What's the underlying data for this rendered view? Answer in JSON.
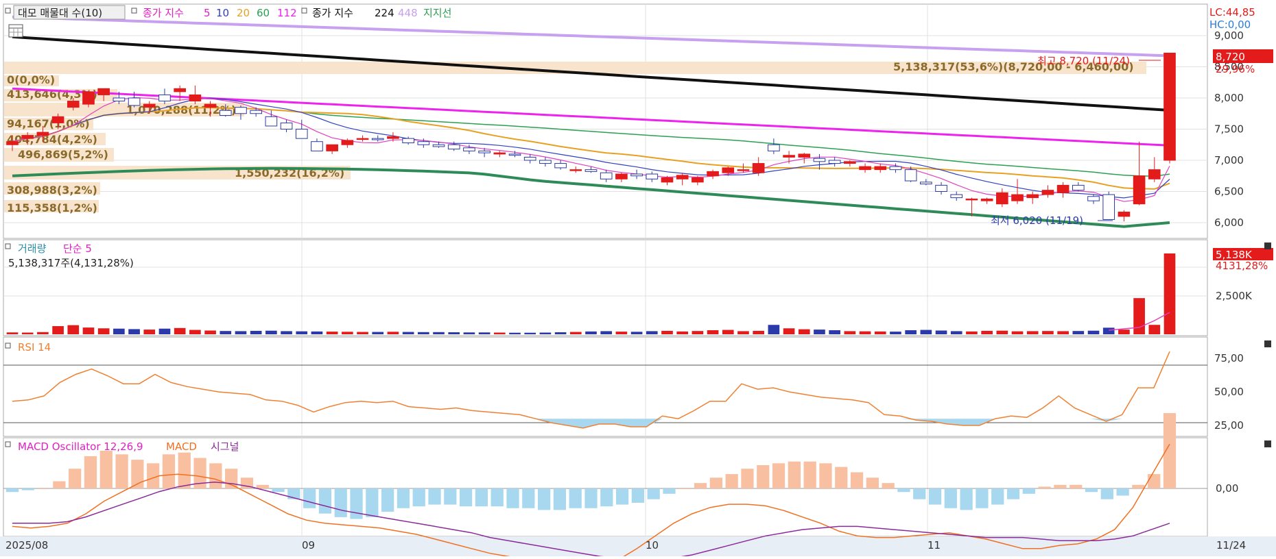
{
  "colors": {
    "up": "#e31b1b",
    "down": "#2b3aa8",
    "ma5": "#e040c0",
    "ma10": "#3040c0",
    "ma20": "#e8a020",
    "ma60": "#2aa050",
    "ma112": "#ee22ee",
    "ma224": "#111111",
    "ma448": "#c8a0f0",
    "support": "#2e8b57",
    "rsi": "#f08030",
    "macd": "#f07020",
    "signal": "#8a2a9a",
    "osc_pos": "#f8c0a0",
    "osc_neg": "#a8d8f0",
    "profile": "#f8e4cc",
    "profile_text": "#8a6a2a",
    "grid": "#e0e0e0"
  },
  "header": {
    "volume_profile_label": "대모 매물대 수(10)",
    "ma_label": "종가 지수",
    "ma_periods_a": [
      "5",
      "10",
      "20",
      "60",
      "112"
    ],
    "ma_label2": "종가 지수",
    "ma_periods_b": [
      "224",
      "448"
    ],
    "support_label": "지지선"
  },
  "price_panel": {
    "lc": "LC:44,85",
    "hc": "HC:0,00",
    "y_ticks": [
      "9,000",
      "8,500",
      "8,000",
      "7,500",
      "7,000",
      "6,500",
      "6,000"
    ],
    "current_price": "8,720",
    "current_change": "29,96%",
    "high_annotation": "최고 8,720 (11/24)",
    "low_annotation": "최저 6,020 (11/19)",
    "volume_profile": [
      {
        "label": "5,138,317(53,6%)(8,720,00 - 6,460,00)"
      },
      {
        "label": "0(0,0%)"
      },
      {
        "label": "413,646(4,3%)"
      },
      {
        "label": "1,070,288(11,2%)"
      },
      {
        "label": "94,167(1,0%)"
      },
      {
        "label": "404,784(4,2%)"
      },
      {
        "label": "496,869(5,2%)"
      },
      {
        "label": "1,550,232(16,2%)"
      },
      {
        "label": "308,988(3,2%)"
      },
      {
        "label": "115,358(1,2%)"
      }
    ]
  },
  "volume_panel": {
    "title": "거래량",
    "ma_label": "단순 5",
    "last_value_text": "5,138,317주(4,131,28%)",
    "last_badge": "5,138K",
    "last_pct": "4131,28%",
    "y_tick": "2,500K"
  },
  "rsi_panel": {
    "title": "RSI 14",
    "y_ticks": [
      "75,00",
      "50,00",
      "25,00"
    ]
  },
  "macd_panel": {
    "title_osc": "MACD Oscillator 12,26,9",
    "title_macd": "MACD",
    "title_signal": "시그널",
    "y_tick": "0,00"
  },
  "x_axis": {
    "labels": [
      "2025/08",
      "09",
      "10",
      "11"
    ],
    "last_label": "11/24"
  },
  "chart_data": {
    "type": "candlestick",
    "ylim": [
      5900,
      9300
    ],
    "candles": [
      {
        "o": 7250,
        "h": 7400,
        "l": 7150,
        "c": 7300
      },
      {
        "o": 7350,
        "h": 7450,
        "l": 7250,
        "c": 7400
      },
      {
        "o": 7400,
        "h": 7550,
        "l": 7300,
        "c": 7450
      },
      {
        "o": 7600,
        "h": 7750,
        "l": 7500,
        "c": 7700
      },
      {
        "o": 7850,
        "h": 8000,
        "l": 7800,
        "c": 7950
      },
      {
        "o": 7900,
        "h": 8050,
        "l": 7850,
        "c": 8100
      },
      {
        "o": 8050,
        "h": 8150,
        "l": 7950,
        "c": 8150
      },
      {
        "o": 8000,
        "h": 8100,
        "l": 7900,
        "c": 7950
      },
      {
        "o": 8000,
        "h": 8100,
        "l": 7850,
        "c": 7880
      },
      {
        "o": 7850,
        "h": 7950,
        "l": 7750,
        "c": 7900
      },
      {
        "o": 8050,
        "h": 8150,
        "l": 7900,
        "c": 7950
      },
      {
        "o": 8100,
        "h": 8200,
        "l": 7950,
        "c": 8150
      },
      {
        "o": 7950,
        "h": 8200,
        "l": 7900,
        "c": 8050
      },
      {
        "o": 7850,
        "h": 7950,
        "l": 7700,
        "c": 7900
      },
      {
        "o": 7800,
        "h": 7900,
        "l": 7700,
        "c": 7720
      },
      {
        "o": 7850,
        "h": 7880,
        "l": 7650,
        "c": 7750
      },
      {
        "o": 7800,
        "h": 7850,
        "l": 7700,
        "c": 7750
      },
      {
        "o": 7700,
        "h": 7800,
        "l": 7550,
        "c": 7550
      },
      {
        "o": 7600,
        "h": 7650,
        "l": 7450,
        "c": 7500
      },
      {
        "o": 7500,
        "h": 7650,
        "l": 7400,
        "c": 7350
      },
      {
        "o": 7300,
        "h": 7350,
        "l": 7200,
        "c": 7150
      },
      {
        "o": 7150,
        "h": 7250,
        "l": 7100,
        "c": 7250
      },
      {
        "o": 7250,
        "h": 7350,
        "l": 7200,
        "c": 7320
      },
      {
        "o": 7350,
        "h": 7400,
        "l": 7300,
        "c": 7350
      },
      {
        "o": 7350,
        "h": 7400,
        "l": 7300,
        "c": 7330
      },
      {
        "o": 7350,
        "h": 7450,
        "l": 7300,
        "c": 7380
      },
      {
        "o": 7350,
        "h": 7380,
        "l": 7250,
        "c": 7280
      },
      {
        "o": 7300,
        "h": 7350,
        "l": 7200,
        "c": 7250
      },
      {
        "o": 7250,
        "h": 7300,
        "l": 7200,
        "c": 7220
      },
      {
        "o": 7250,
        "h": 7300,
        "l": 7150,
        "c": 7180
      },
      {
        "o": 7200,
        "h": 7250,
        "l": 7100,
        "c": 7150
      },
      {
        "o": 7150,
        "h": 7200,
        "l": 7050,
        "c": 7120
      },
      {
        "o": 7100,
        "h": 7150,
        "l": 7050,
        "c": 7120
      },
      {
        "o": 7100,
        "h": 7150,
        "l": 7050,
        "c": 7080
      },
      {
        "o": 7050,
        "h": 7100,
        "l": 6950,
        "c": 7000
      },
      {
        "o": 7000,
        "h": 7050,
        "l": 6900,
        "c": 6950
      },
      {
        "o": 6950,
        "h": 7000,
        "l": 6850,
        "c": 6880
      },
      {
        "o": 6850,
        "h": 6900,
        "l": 6800,
        "c": 6850
      },
      {
        "o": 6850,
        "h": 6900,
        "l": 6800,
        "c": 6820
      },
      {
        "o": 6800,
        "h": 6850,
        "l": 6650,
        "c": 6700
      },
      {
        "o": 6700,
        "h": 6800,
        "l": 6650,
        "c": 6780
      },
      {
        "o": 6780,
        "h": 6850,
        "l": 6700,
        "c": 6750
      },
      {
        "o": 6780,
        "h": 6820,
        "l": 6650,
        "c": 6700
      },
      {
        "o": 6650,
        "h": 6750,
        "l": 6600,
        "c": 6720
      },
      {
        "o": 6700,
        "h": 6800,
        "l": 6600,
        "c": 6760
      },
      {
        "o": 6650,
        "h": 6750,
        "l": 6600,
        "c": 6720
      },
      {
        "o": 6750,
        "h": 6850,
        "l": 6700,
        "c": 6820
      },
      {
        "o": 6800,
        "h": 6900,
        "l": 6750,
        "c": 6880
      },
      {
        "o": 6850,
        "h": 6950,
        "l": 6800,
        "c": 6850
      },
      {
        "o": 6800,
        "h": 7050,
        "l": 6750,
        "c": 6950
      },
      {
        "o": 7250,
        "h": 7350,
        "l": 7100,
        "c": 7150
      },
      {
        "o": 7050,
        "h": 7150,
        "l": 6950,
        "c": 7080
      },
      {
        "o": 7050,
        "h": 7120,
        "l": 6950,
        "c": 7100
      },
      {
        "o": 7030,
        "h": 7100,
        "l": 6850,
        "c": 6980
      },
      {
        "o": 7000,
        "h": 7050,
        "l": 6900,
        "c": 6950
      },
      {
        "o": 6950,
        "h": 7000,
        "l": 6900,
        "c": 6980
      },
      {
        "o": 6850,
        "h": 6950,
        "l": 6800,
        "c": 6900
      },
      {
        "o": 6850,
        "h": 6950,
        "l": 6800,
        "c": 6900
      },
      {
        "o": 6900,
        "h": 6950,
        "l": 6800,
        "c": 6850
      },
      {
        "o": 6850,
        "h": 6900,
        "l": 6650,
        "c": 6670
      },
      {
        "o": 6650,
        "h": 6700,
        "l": 6600,
        "c": 6620
      },
      {
        "o": 6600,
        "h": 6650,
        "l": 6450,
        "c": 6500
      },
      {
        "o": 6450,
        "h": 6500,
        "l": 6350,
        "c": 6400
      },
      {
        "o": 6380,
        "h": 6400,
        "l": 6100,
        "c": 6380
      },
      {
        "o": 6350,
        "h": 6400,
        "l": 6300,
        "c": 6380
      },
      {
        "o": 6300,
        "h": 6550,
        "l": 6250,
        "c": 6480
      },
      {
        "o": 6350,
        "h": 6700,
        "l": 6300,
        "c": 6450
      },
      {
        "o": 6400,
        "h": 6500,
        "l": 6300,
        "c": 6450
      },
      {
        "o": 6450,
        "h": 6600,
        "l": 6400,
        "c": 6520
      },
      {
        "o": 6480,
        "h": 6650,
        "l": 6400,
        "c": 6600
      },
      {
        "o": 6600,
        "h": 6650,
        "l": 6500,
        "c": 6520
      },
      {
        "o": 6420,
        "h": 6450,
        "l": 6300,
        "c": 6350
      },
      {
        "o": 6450,
        "h": 6500,
        "l": 6050,
        "c": 6050
      },
      {
        "o": 6100,
        "h": 6200,
        "l": 6020,
        "c": 6170
      },
      {
        "o": 6300,
        "h": 7300,
        "l": 6280,
        "c": 6750
      },
      {
        "o": 6700,
        "h": 7050,
        "l": 6650,
        "c": 6850
      },
      {
        "o": 7000,
        "h": 8720,
        "l": 6950,
        "c": 8720
      }
    ],
    "volume": [
      120,
      110,
      140,
      520,
      580,
      430,
      380,
      360,
      330,
      300,
      360,
      400,
      280,
      240,
      210,
      200,
      220,
      230,
      200,
      190,
      180,
      170,
      160,
      150,
      150,
      160,
      150,
      140,
      140,
      130,
      120,
      120,
      110,
      100,
      100,
      110,
      130,
      150,
      180,
      200,
      170,
      160,
      200,
      220,
      180,
      210,
      260,
      280,
      200,
      220,
      600,
      380,
      320,
      300,
      260,
      200,
      190,
      180,
      170,
      260,
      280,
      240,
      200,
      180,
      220,
      230,
      190,
      200,
      210,
      200,
      210,
      230,
      420,
      300,
      2300,
      600,
      5138
    ],
    "rsi": [
      43,
      44,
      47,
      57,
      63,
      67,
      62,
      56,
      56,
      63,
      57,
      54,
      52,
      50,
      49,
      48,
      44,
      43,
      40,
      35,
      39,
      42,
      43,
      42,
      43,
      39,
      38,
      37,
      38,
      36,
      35,
      34,
      33,
      30,
      27,
      25,
      23,
      26,
      26,
      24,
      24,
      32,
      30,
      36,
      43,
      43,
      56,
      52,
      53,
      50,
      48,
      46,
      45,
      44,
      42,
      33,
      32,
      29,
      28,
      26,
      25,
      25,
      30,
      32,
      31,
      38,
      47,
      38,
      33,
      28,
      33,
      53,
      53,
      80
    ],
    "macd_osc": [
      -10,
      -5,
      0,
      20,
      55,
      90,
      105,
      95,
      80,
      70,
      95,
      100,
      85,
      70,
      55,
      30,
      10,
      -10,
      -30,
      -55,
      -70,
      -80,
      -85,
      -80,
      -65,
      -55,
      -50,
      -45,
      -45,
      -50,
      -50,
      -50,
      -55,
      -55,
      -60,
      -60,
      -55,
      -55,
      -50,
      -45,
      -40,
      -30,
      -15,
      0,
      15,
      30,
      40,
      55,
      65,
      70,
      75,
      75,
      70,
      60,
      45,
      30,
      15,
      -10,
      -30,
      -45,
      -55,
      -60,
      -55,
      -45,
      -30,
      -15,
      5,
      10,
      10,
      -10,
      -30,
      -20,
      10,
      40,
      210
    ],
    "macd": [
      -120,
      -125,
      -120,
      -110,
      -80,
      -40,
      -10,
      20,
      40,
      45,
      40,
      30,
      10,
      -20,
      -50,
      -80,
      -100,
      -110,
      -115,
      -120,
      -125,
      -135,
      -145,
      -160,
      -175,
      -190,
      -205,
      -215,
      -225,
      -235,
      -240,
      -240,
      -235,
      -225,
      -190,
      -150,
      -110,
      -80,
      -60,
      -50,
      -50,
      -55,
      -70,
      -90,
      -110,
      -135,
      -150,
      -155,
      -155,
      -150,
      -145,
      -140,
      -150,
      -160,
      -175,
      -190,
      -190,
      -180,
      -175,
      -160,
      -130,
      -60,
      40,
      140
    ],
    "signal": [
      -110,
      -110,
      -110,
      -105,
      -90,
      -70,
      -50,
      -30,
      -10,
      5,
      15,
      20,
      15,
      5,
      -10,
      -25,
      -40,
      -55,
      -70,
      -80,
      -90,
      -100,
      -110,
      -120,
      -130,
      -140,
      -155,
      -165,
      -175,
      -185,
      -195,
      -205,
      -215,
      -220,
      -225,
      -225,
      -220,
      -210,
      -195,
      -180,
      -165,
      -150,
      -140,
      -130,
      -125,
      -120,
      -120,
      -125,
      -130,
      -135,
      -140,
      -145,
      -150,
      -155,
      -155,
      -155,
      -160,
      -165,
      -165,
      -165,
      -160,
      -150,
      -130,
      -110
    ]
  }
}
